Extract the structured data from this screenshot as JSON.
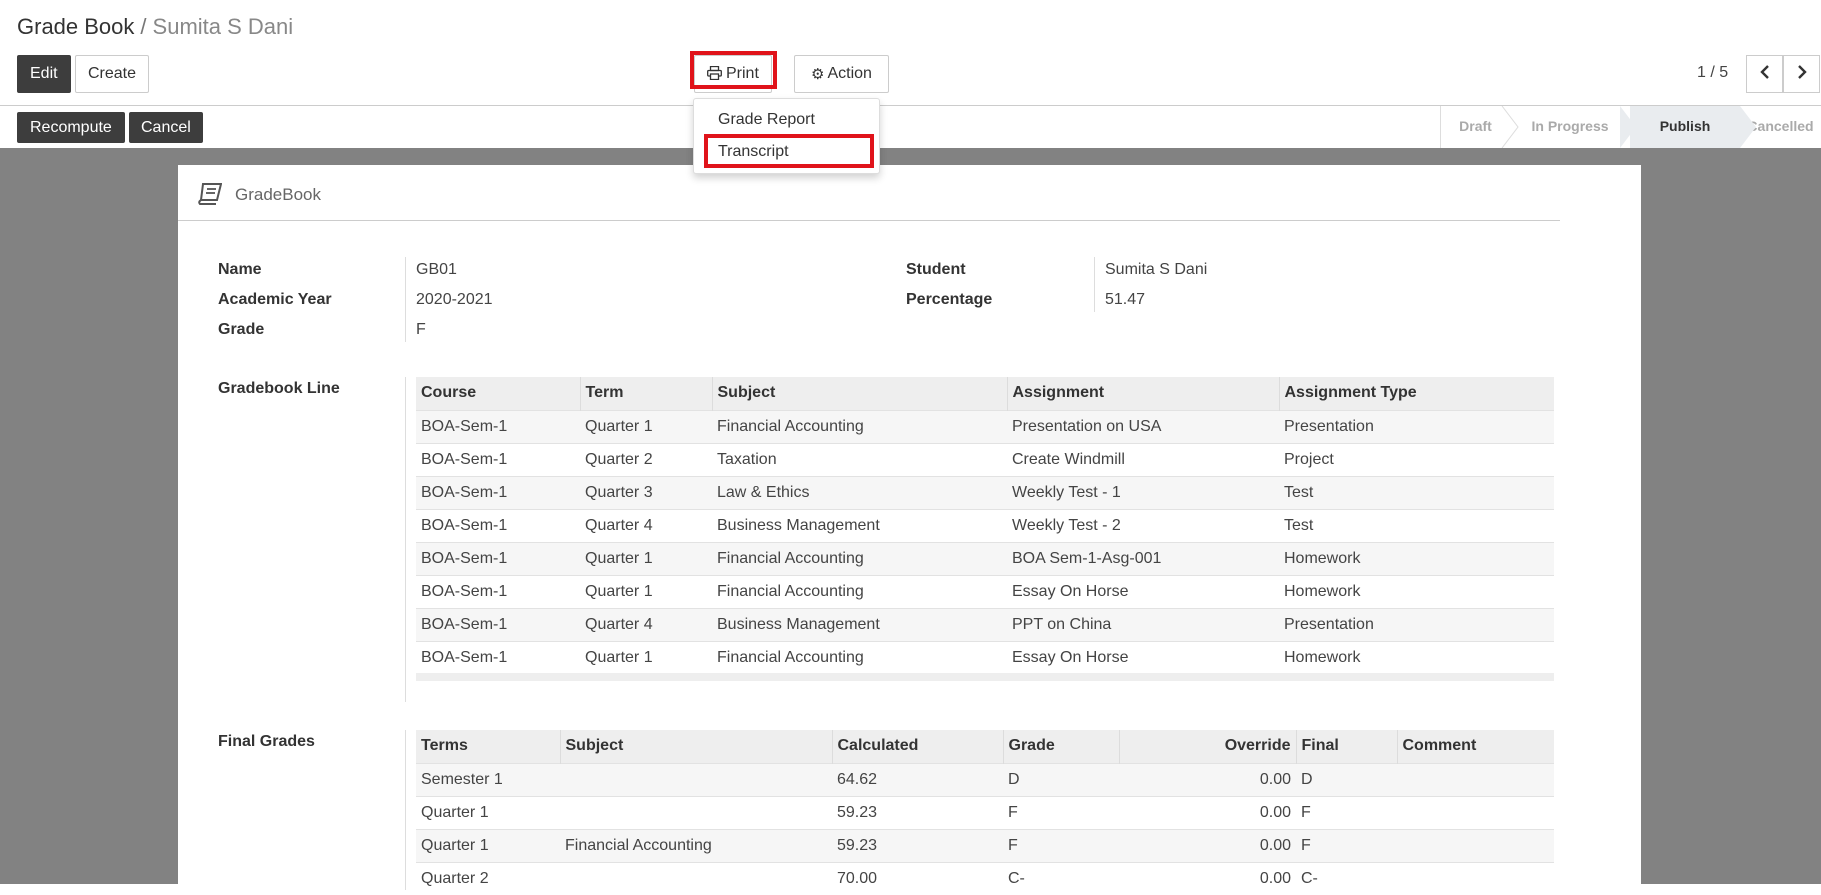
{
  "breadcrumb": {
    "parent": "Grade Book",
    "separator": "/",
    "current": "Sumita S Dani"
  },
  "toolbar": {
    "edit_label": "Edit",
    "create_label": "Create",
    "print_label": "Print",
    "action_label": "Action",
    "pager": "1 / 5"
  },
  "print_menu": {
    "items": [
      "Grade Report",
      "Transcript"
    ]
  },
  "header_buttons": {
    "recompute_label": "Recompute",
    "cancel_label": "Cancel"
  },
  "statusbar": {
    "stages": [
      "Draft",
      "In Progress",
      "Publish",
      "Cancelled"
    ],
    "active": "Publish"
  },
  "sheet": {
    "title": "GradeBook",
    "fields": {
      "name_label": "Name",
      "name_value": "GB01",
      "year_label": "Academic Year",
      "year_value": "2020-2021",
      "grade_label": "Grade",
      "grade_value": "F",
      "student_label": "Student",
      "student_value": "Sumita S Dani",
      "percentage_label": "Percentage",
      "percentage_value": "51.47"
    },
    "gradebook_line": {
      "label": "Gradebook Line",
      "columns": [
        "Course",
        "Term",
        "Subject",
        "Assignment",
        "Assignment Type"
      ],
      "rows": [
        [
          "BOA-Sem-1",
          "Quarter 1",
          "Financial Accounting",
          "Presentation on USA",
          "Presentation"
        ],
        [
          "BOA-Sem-1",
          "Quarter 2",
          "Taxation",
          "Create Windmill",
          "Project"
        ],
        [
          "BOA-Sem-1",
          "Quarter 3",
          "Law & Ethics",
          "Weekly Test - 1",
          "Test"
        ],
        [
          "BOA-Sem-1",
          "Quarter 4",
          "Business Management",
          "Weekly Test - 2",
          "Test"
        ],
        [
          "BOA-Sem-1",
          "Quarter 1",
          "Financial Accounting",
          "BOA Sem-1-Asg-001",
          "Homework"
        ],
        [
          "BOA-Sem-1",
          "Quarter 1",
          "Financial Accounting",
          "Essay On Horse",
          "Homework"
        ],
        [
          "BOA-Sem-1",
          "Quarter 4",
          "Business Management",
          "PPT on China",
          "Presentation"
        ],
        [
          "BOA-Sem-1",
          "Quarter 1",
          "Financial Accounting",
          "Essay On Horse",
          "Homework"
        ]
      ]
    },
    "final_grades": {
      "label": "Final Grades",
      "columns": [
        "Terms",
        "Subject",
        "Calculated",
        "Grade",
        "Override",
        "Final",
        "Comment"
      ],
      "rows": [
        [
          "Semester 1",
          "",
          "64.62",
          "D",
          "0.00",
          "D",
          ""
        ],
        [
          "Quarter 1",
          "",
          "59.23",
          "F",
          "0.00",
          "F",
          ""
        ],
        [
          "Quarter 1",
          "Financial Accounting",
          "59.23",
          "F",
          "0.00",
          "F",
          ""
        ],
        [
          "Quarter 2",
          "",
          "70.00",
          "C-",
          "0.00",
          "C-",
          ""
        ]
      ]
    }
  }
}
